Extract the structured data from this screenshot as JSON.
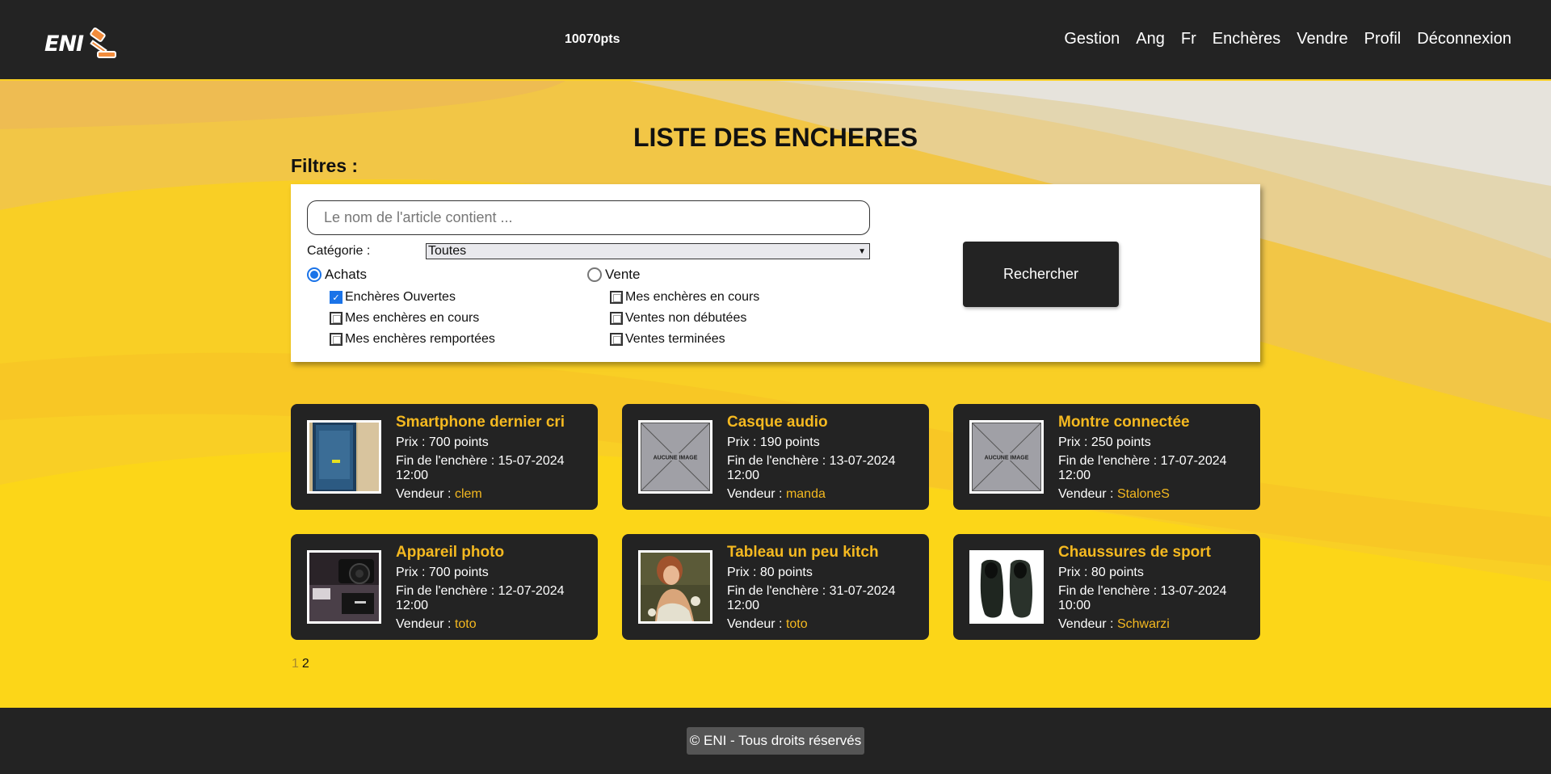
{
  "header": {
    "logo_text": "ENI",
    "points": "10070pts",
    "nav": [
      "Gestion",
      "Ang",
      "Fr",
      "Enchères",
      "Vendre",
      "Profil",
      "Déconnexion"
    ]
  },
  "main": {
    "title": "LISTE DES ENCHERES",
    "filters_label": "Filtres :"
  },
  "filters": {
    "search_placeholder": "Le nom de l'article contient ...",
    "category_label": "Catégorie :",
    "category_value": "Toutes",
    "achats": {
      "label": "Achats",
      "selected": true,
      "options": [
        {
          "label": "Enchères Ouvertes",
          "checked": true
        },
        {
          "label": "Mes enchères en cours",
          "checked": false
        },
        {
          "label": "Mes enchères remportées",
          "checked": false
        }
      ]
    },
    "vente": {
      "label": "Vente",
      "selected": false,
      "options": [
        {
          "label": "Mes enchères en cours",
          "checked": false
        },
        {
          "label": "Ventes non débutées",
          "checked": false
        },
        {
          "label": "Ventes terminées",
          "checked": false
        }
      ]
    },
    "search_button": "Rechercher"
  },
  "no_image_text": "AUCUNE IMAGE",
  "auctions": [
    {
      "title": "Smartphone dernier cri",
      "price": "Prix : 700 points",
      "end": "Fin de l'enchère : 15-07-2024 12:00",
      "seller_label": "Vendeur : ",
      "seller": "clem",
      "image": "phone-photo"
    },
    {
      "title": "Casque audio",
      "price": "Prix : 190 points",
      "end": "Fin de l'enchère : 13-07-2024 12:00",
      "seller_label": "Vendeur : ",
      "seller": "manda",
      "image": "none"
    },
    {
      "title": "Montre connectée",
      "price": "Prix : 250 points",
      "end": "Fin de l'enchère : 17-07-2024 12:00",
      "seller_label": "Vendeur : ",
      "seller": "StaloneS",
      "image": "none"
    },
    {
      "title": "Appareil photo",
      "price": "Prix : 700 points",
      "end": "Fin de l'enchère : 12-07-2024 12:00",
      "seller_label": "Vendeur : ",
      "seller": "toto",
      "image": "camera-photo"
    },
    {
      "title": "Tableau un peu kitch",
      "price": "Prix : 80 points",
      "end": "Fin de l'enchère : 31-07-2024 12:00",
      "seller_label": "Vendeur : ",
      "seller": "toto",
      "image": "painting-photo"
    },
    {
      "title": "Chaussures de sport",
      "price": "Prix : 80 points",
      "end": "Fin de l'enchère : 13-07-2024 10:00",
      "seller_label": "Vendeur : ",
      "seller": "Schwarzi",
      "image": "shoes-photo"
    }
  ],
  "pagination": {
    "current": "1",
    "next": "2"
  },
  "footer": {
    "copyright": "© ENI - Tous droits réservés"
  },
  "colors": {
    "dark": "#232323",
    "accent": "#f5b920",
    "background": "#f7c52a"
  }
}
